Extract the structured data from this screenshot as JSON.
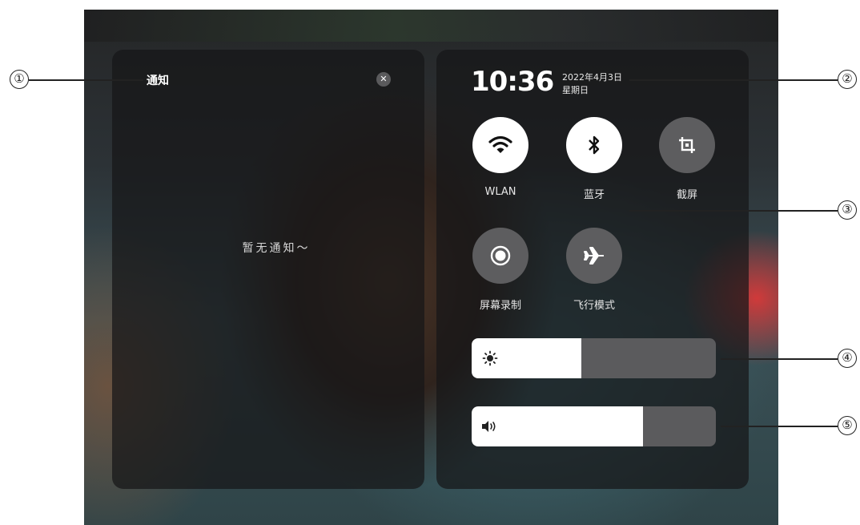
{
  "notifications": {
    "title": "通知",
    "close_icon": "close-icon",
    "empty_message": "暂无通知～"
  },
  "control_center": {
    "time": "10:36",
    "date": "2022年4月3日",
    "weekday": "星期日",
    "toggles": [
      {
        "label": "WLAN",
        "icon": "wifi-icon",
        "state": "on"
      },
      {
        "label": "蓝牙",
        "icon": "bluetooth-icon",
        "state": "on"
      },
      {
        "label": "截屏",
        "icon": "crop-icon",
        "state": "off"
      },
      {
        "label": "屏幕录制",
        "icon": "record-icon",
        "state": "off"
      },
      {
        "label": "飞行模式",
        "icon": "airplane-icon",
        "state": "off"
      }
    ],
    "brightness": {
      "icon": "sun-icon",
      "level": 0.45
    },
    "volume": {
      "icon": "speaker-icon",
      "level": 0.7
    }
  },
  "callouts": [
    "①",
    "②",
    "③",
    "④",
    "⑤"
  ],
  "colors": {
    "panel": "#161618",
    "toggle_on": "#ffffff",
    "toggle_off": "#5d5d5f",
    "slider_track": "#5b5b5d",
    "slider_fill": "#ffffff"
  }
}
